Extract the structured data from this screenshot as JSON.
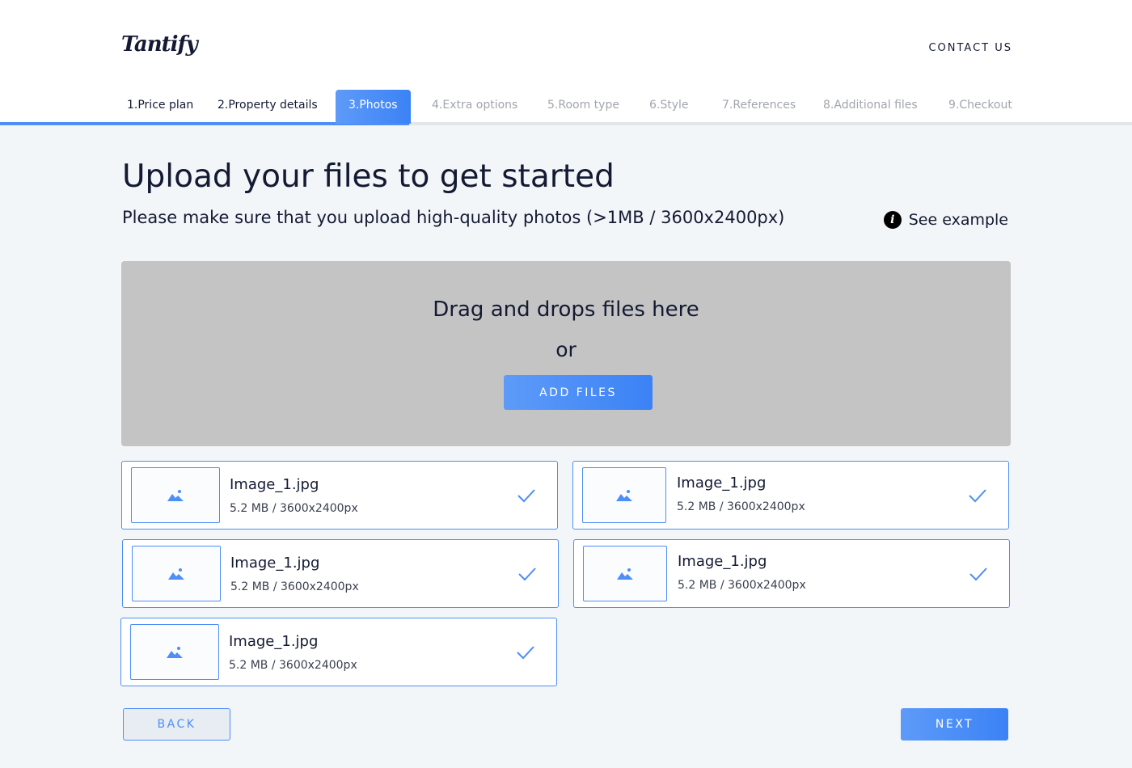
{
  "header": {
    "logo": "Tantify",
    "contact_label": "CONTACT US"
  },
  "steps": [
    {
      "label": "1.Price plan",
      "state": "done"
    },
    {
      "label": "2.Property details",
      "state": "done"
    },
    {
      "label": "3.Photos",
      "state": "active"
    },
    {
      "label": "4.Extra options",
      "state": "pending"
    },
    {
      "label": "5.Room type",
      "state": "pending"
    },
    {
      "label": "6.Style",
      "state": "pending"
    },
    {
      "label": "7.References",
      "state": "pending"
    },
    {
      "label": "8.Additional files",
      "state": "pending"
    },
    {
      "label": "9.Checkout",
      "state": "pending"
    }
  ],
  "main": {
    "title": "Upload your files to get started",
    "subtitle": "Please make sure that you upload high-quality photos (>1MB / 3600x2400px)",
    "see_example": "See example"
  },
  "dropzone": {
    "text": "Drag and drops files here",
    "or": "or",
    "button": "ADD FILES"
  },
  "files": [
    {
      "name": "Image_1.jpg",
      "meta": "5.2 MB / 3600x2400px"
    },
    {
      "name": "Image_1.jpg",
      "meta": "5.2 MB / 3600x2400px"
    },
    {
      "name": "Image_1.jpg",
      "meta": "5.2 MB / 3600x2400px"
    },
    {
      "name": "Image_1.jpg",
      "meta": "5.2 MB / 3600x2400px"
    },
    {
      "name": "Image_1.jpg",
      "meta": "5.2 MB / 3600x2400px"
    }
  ],
  "footer": {
    "back": "BACK",
    "next": "NEXT"
  },
  "colors": {
    "accent": "#4d8ef7",
    "text": "#141a33",
    "dropzone_bg": "#c4c4c4",
    "page_bg": "#f3f6f8"
  }
}
